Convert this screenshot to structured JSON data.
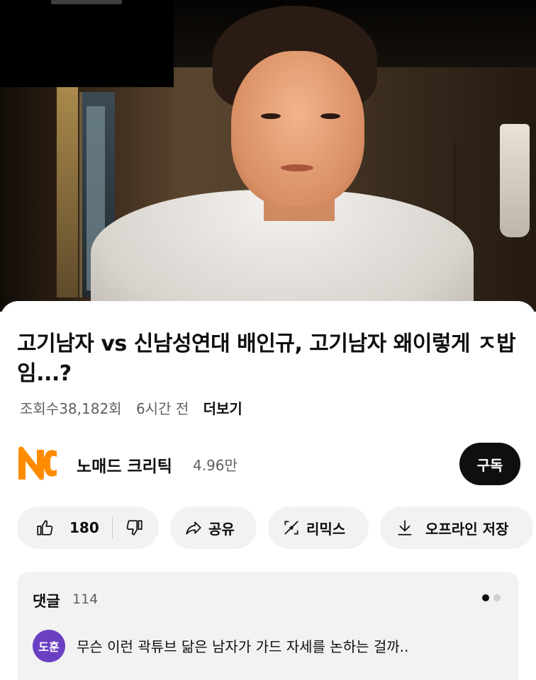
{
  "video": {
    "title": "고기남자 vs 신남성연대 배인규, 고기남자 왜이렇게 ㅈ밥임...?",
    "views": "조회수38,182회",
    "age": "6시간 전",
    "more_label": "더보기"
  },
  "channel": {
    "name": "노매드 크리틱",
    "subscribers": "4.96만",
    "subscribe_label": "구독",
    "logo_color": "#ff8c00"
  },
  "actions": {
    "like_count": "180",
    "share_label": "공유",
    "remix_label": "리믹스",
    "download_label": "오프라인 저장"
  },
  "comments": {
    "heading": "댓글",
    "count": "114",
    "top_comment": {
      "avatar_text": "도훈",
      "avatar_color": "#6b3fc2",
      "text": "무슨 이런 곽튜브 닮은 남자가 가드 자세를 논하는 걸까.."
    }
  }
}
